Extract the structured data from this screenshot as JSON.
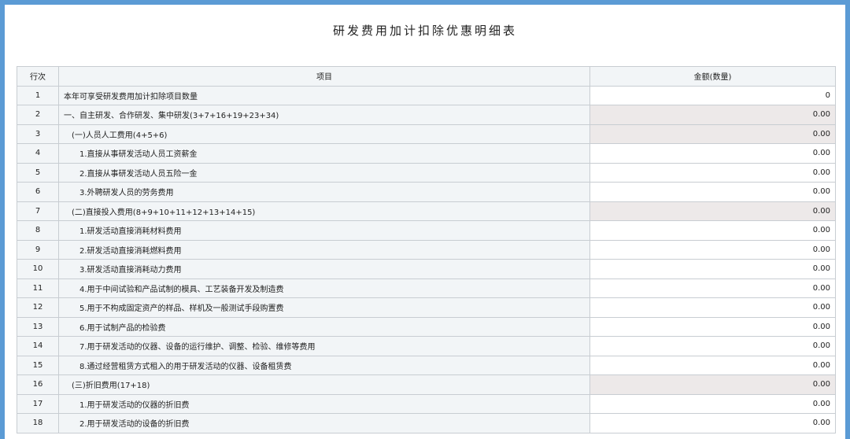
{
  "title": "研发费用加计扣除优惠明细表",
  "headers": {
    "row": "行次",
    "item": "项目",
    "amount": "金额(数量)"
  },
  "rows": [
    {
      "no": "1",
      "label": "本年可享受研发费用加计扣除项目数量",
      "value": "0",
      "level": 1,
      "shaded": false
    },
    {
      "no": "2",
      "label": "一、自主研发、合作研发、集中研发(3+7+16+19+23+34)",
      "value": "0.00",
      "level": 1,
      "shaded": true
    },
    {
      "no": "3",
      "label": "(一)人员人工费用(4+5+6)",
      "value": "0.00",
      "level": 2,
      "shaded": true
    },
    {
      "no": "4",
      "label": "1.直接从事研发活动人员工资薪金",
      "value": "0.00",
      "level": 3,
      "shaded": false
    },
    {
      "no": "5",
      "label": "2.直接从事研发活动人员五险一金",
      "value": "0.00",
      "level": 3,
      "shaded": false
    },
    {
      "no": "6",
      "label": "3.外聘研发人员的劳务费用",
      "value": "0.00",
      "level": 3,
      "shaded": false
    },
    {
      "no": "7",
      "label": "(二)直接投入费用(8+9+10+11+12+13+14+15)",
      "value": "0.00",
      "level": 2,
      "shaded": true
    },
    {
      "no": "8",
      "label": "1.研发活动直接消耗材料费用",
      "value": "0.00",
      "level": 3,
      "shaded": false
    },
    {
      "no": "9",
      "label": "2.研发活动直接消耗燃料费用",
      "value": "0.00",
      "level": 3,
      "shaded": false
    },
    {
      "no": "10",
      "label": "3.研发活动直接消耗动力费用",
      "value": "0.00",
      "level": 3,
      "shaded": false
    },
    {
      "no": "11",
      "label": "4.用于中间试验和产品试制的模具、工艺装备开发及制造费",
      "value": "0.00",
      "level": 3,
      "shaded": false
    },
    {
      "no": "12",
      "label": "5.用于不构成固定资产的样品、样机及一般测试手段购置费",
      "value": "0.00",
      "level": 3,
      "shaded": false
    },
    {
      "no": "13",
      "label": "6.用于试制产品的检验费",
      "value": "0.00",
      "level": 3,
      "shaded": false
    },
    {
      "no": "14",
      "label": "7.用于研发活动的仪器、设备的运行维护、调整、检验、维修等费用",
      "value": "0.00",
      "level": 3,
      "shaded": false
    },
    {
      "no": "15",
      "label": "8.通过经营租赁方式租入的用于研发活动的仪器、设备租赁费",
      "value": "0.00",
      "level": 3,
      "shaded": false
    },
    {
      "no": "16",
      "label": "(三)折旧费用(17+18)",
      "value": "0.00",
      "level": 2,
      "shaded": true
    },
    {
      "no": "17",
      "label": "1.用于研发活动的仪器的折旧费",
      "value": "0.00",
      "level": 3,
      "shaded": false
    },
    {
      "no": "18",
      "label": "2.用于研发活动的设备的折旧费",
      "value": "0.00",
      "level": 3,
      "shaded": false
    }
  ],
  "colors": {
    "frame": "#5b9bd5",
    "shaded_cell": "#ede9e9",
    "label_cell": "#f2f5f7",
    "border": "#c8cdd2"
  }
}
